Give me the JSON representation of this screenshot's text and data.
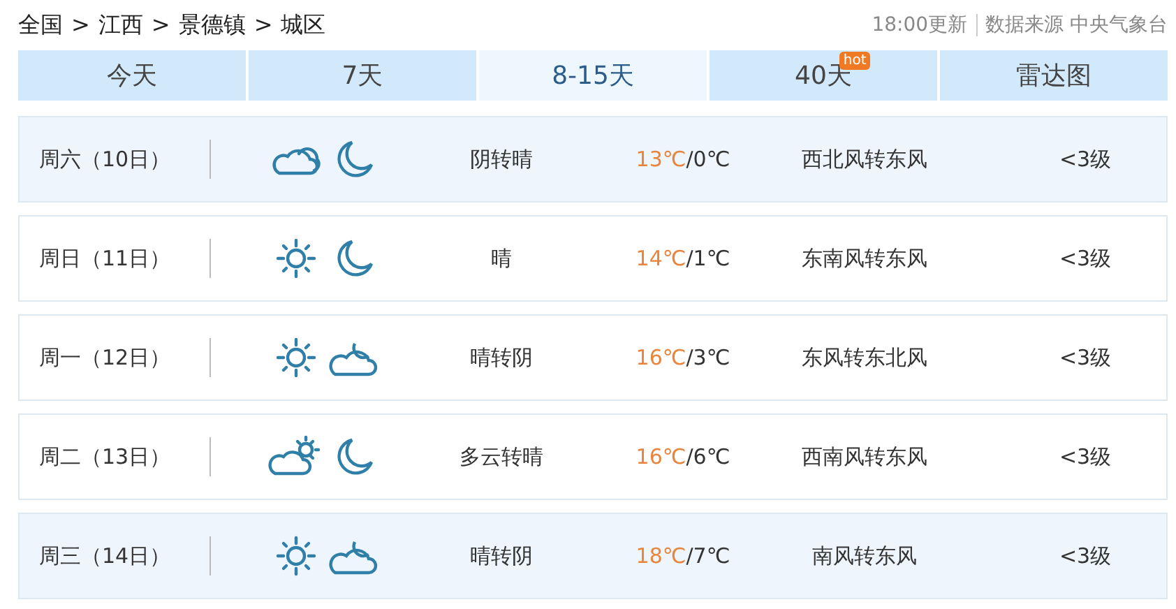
{
  "breadcrumb": [
    {
      "label": "全国"
    },
    {
      "label": "江西"
    },
    {
      "label": "景德镇"
    },
    {
      "label": "城区"
    }
  ],
  "separator": ">",
  "update_time": "18:00更新",
  "source": "数据来源 中央气象台",
  "tabs": [
    {
      "label": "今天",
      "selected": false
    },
    {
      "label": "7天",
      "selected": false
    },
    {
      "label": "8-15天",
      "selected": true
    },
    {
      "label": "40天",
      "selected": false,
      "badge": "hot"
    },
    {
      "label": "雷达图",
      "selected": false
    }
  ],
  "days": [
    {
      "day": "周六（10日）",
      "icons": [
        {
          "kind": "overcast"
        },
        {
          "kind": "moon"
        }
      ],
      "weather": "阴转晴",
      "high": "13℃",
      "low": "/0℃",
      "wind": "西北风转东风",
      "level": "<3级",
      "highlighted": true
    },
    {
      "day": "周日（11日）",
      "icons": [
        {
          "kind": "sun"
        },
        {
          "kind": "moon"
        }
      ],
      "weather": "晴",
      "high": "14℃",
      "low": "/1℃",
      "wind": "东南风转东风",
      "level": "<3级",
      "highlighted": false
    },
    {
      "day": "周一（12日）",
      "icons": [
        {
          "kind": "sun"
        },
        {
          "kind": "cloudy-night"
        }
      ],
      "weather": "晴转阴",
      "high": "16℃",
      "low": "/3℃",
      "wind": "东风转东北风",
      "level": "<3级",
      "highlighted": false
    },
    {
      "day": "周二（13日）",
      "icons": [
        {
          "kind": "cloudy-day"
        },
        {
          "kind": "moon"
        }
      ],
      "weather": "多云转晴",
      "high": "16℃",
      "low": "/6℃",
      "wind": "西南风转东风",
      "level": "<3级",
      "highlighted": false
    },
    {
      "day": "周三（14日）",
      "icons": [
        {
          "kind": "sun"
        },
        {
          "kind": "cloudy-night"
        }
      ],
      "weather": "晴转阴",
      "high": "18℃",
      "low": "/7℃",
      "wind": "南风转东风",
      "level": "<3级",
      "highlighted": true
    }
  ]
}
